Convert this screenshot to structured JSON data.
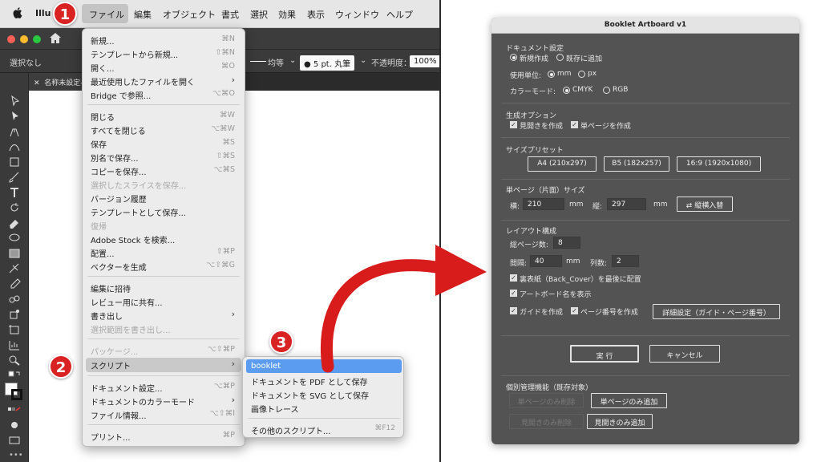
{
  "menubar": {
    "app_name": "Illu",
    "items": [
      "ファイル",
      "編集",
      "オブジェクト",
      "書式",
      "選択",
      "効果",
      "表示",
      "ウィンドウ",
      "ヘルプ"
    ]
  },
  "control_bar": {
    "selection": "選択なし",
    "stroke_style": "均等",
    "brush": "5 pt. 丸筆",
    "opacity_label": "不透明度：",
    "opacity_value": "100%"
  },
  "doc_tab": {
    "title": "名称未設定-"
  },
  "file_menu": {
    "items": [
      {
        "label": "新規...",
        "shortcut": "⌘N"
      },
      {
        "label": "テンプレートから新規...",
        "shortcut": "⇧⌘N"
      },
      {
        "label": "開く...",
        "shortcut": "⌘O"
      },
      {
        "label": "最近使用したファイルを開く",
        "shortcut": ""
      },
      {
        "label": "Bridge で参照...",
        "shortcut": "⌥⌘O"
      },
      {
        "label": "閉じる",
        "shortcut": "⌘W"
      },
      {
        "label": "すべてを閉じる",
        "shortcut": "⌥⌘W"
      },
      {
        "label": "保存",
        "shortcut": "⌘S"
      },
      {
        "label": "別名で保存...",
        "shortcut": "⇧⌘S"
      },
      {
        "label": "コピーを保存...",
        "shortcut": "⌥⌘S"
      },
      {
        "label": "選択したスライスを保存...",
        "shortcut": ""
      },
      {
        "label": "バージョン履歴",
        "shortcut": ""
      },
      {
        "label": "テンプレートとして保存...",
        "shortcut": ""
      },
      {
        "label": "復帰",
        "shortcut": ""
      },
      {
        "label": "Adobe Stock を検索...",
        "shortcut": ""
      },
      {
        "label": "配置...",
        "shortcut": "⇧⌘P"
      },
      {
        "label": "ベクターを生成",
        "shortcut": "⌥⇧⌘G"
      },
      {
        "label": "編集に招待",
        "shortcut": ""
      },
      {
        "label": "レビュー用に共有...",
        "shortcut": ""
      },
      {
        "label": "書き出し",
        "shortcut": ""
      },
      {
        "label": "選択範囲を書き出し...",
        "shortcut": ""
      },
      {
        "label": "パッケージ...",
        "shortcut": "⌥⇧⌘P"
      },
      {
        "label": "スクリプト",
        "shortcut": ""
      },
      {
        "label": "ドキュメント設定...",
        "shortcut": "⌥⌘P"
      },
      {
        "label": "ドキュメントのカラーモード",
        "shortcut": ""
      },
      {
        "label": "ファイル情報...",
        "shortcut": "⌥⇧⌘I"
      },
      {
        "label": "プリント...",
        "shortcut": "⌘P"
      }
    ]
  },
  "script_submenu": {
    "items": [
      {
        "label": "booklet",
        "shortcut": ""
      },
      {
        "label": "ドキュメントを PDF として保存",
        "shortcut": ""
      },
      {
        "label": "ドキュメントを SVG として保存",
        "shortcut": ""
      },
      {
        "label": "画像トレース",
        "shortcut": ""
      },
      {
        "label": "その他のスクリプト...",
        "shortcut": "⌘F12"
      }
    ]
  },
  "badges": [
    "1",
    "2",
    "3"
  ],
  "dialog": {
    "title": "Booklet Artboard v1",
    "doc_settings": {
      "heading": "ドキュメント設定",
      "new_doc": "新規作成",
      "add_existing": "既存に追加",
      "unit_label": "使用単位:",
      "unit_mm": "mm",
      "unit_px": "px",
      "color_mode_label": "カラーモード:",
      "cmyk": "CMYK",
      "rgb": "RGB"
    },
    "gen_options": {
      "heading": "生成オプション",
      "spreads": "見開きを作成",
      "single": "単ページを作成"
    },
    "size_presets": {
      "heading": "サイズプリセット",
      "a4": "A4 (210x297)",
      "b5": "B5 (182x257)",
      "wide": "16:9 (1920x1080)"
    },
    "page_size": {
      "heading": "単ページ（片面）サイズ",
      "width_label": "横:",
      "width_value": "210",
      "unit1": "mm",
      "height_label": "縦:",
      "height_value": "297",
      "unit2": "mm",
      "swap_button": "⇄ 縦横入替"
    },
    "layout": {
      "heading": "レイアウト構成",
      "total_pages_label": "総ページ数:",
      "total_pages_value": "8",
      "spacing_label": "間隔:",
      "spacing_value": "40",
      "spacing_unit": "mm",
      "columns_label": "列数:",
      "columns_value": "2",
      "back_cover": "裏表紙（Back_Cover）を最後に配置",
      "show_names": "アートボード名を表示",
      "create_guides": "ガイドを作成",
      "page_numbers": "ページ番号を作成",
      "detail_button": "詳細設定（ガイド・ページ番号）"
    },
    "run_button": "実 行",
    "cancel_button": "キャンセル",
    "individual": {
      "heading": "個別管理機能（既存対象）",
      "remove_single": "単ページのみ削除",
      "add_single": "単ページのみ追加",
      "remove_spread": "見開きのみ削除",
      "add_spread": "見開きのみ追加"
    }
  }
}
